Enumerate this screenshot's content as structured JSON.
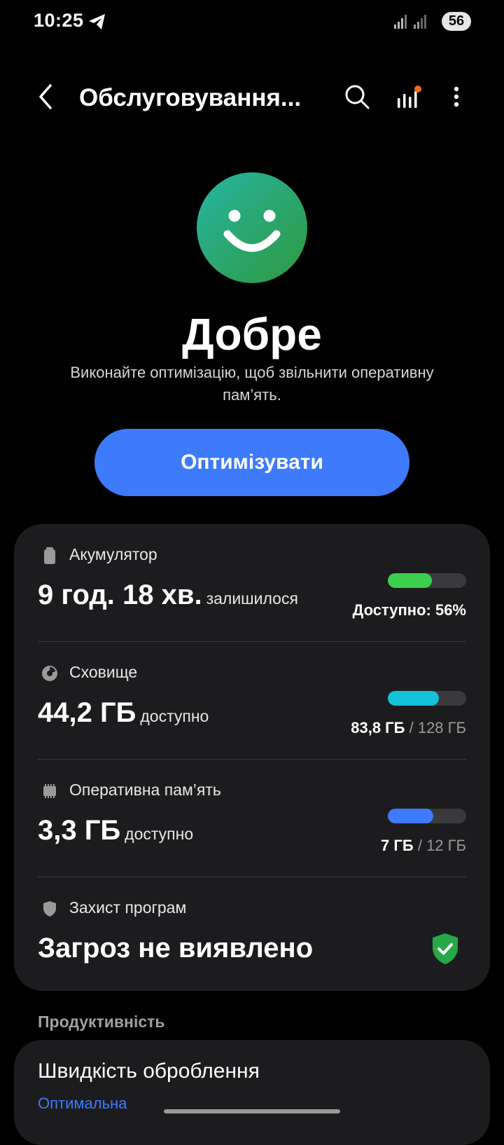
{
  "status_bar": {
    "time": "10:25",
    "battery": "56"
  },
  "app_bar": {
    "title": "Обслуговування..."
  },
  "status": {
    "word": "Добре",
    "description": "Виконайте оптимізацію, щоб звільнити оперативну пам’ять.",
    "button_label": "Оптимізувати"
  },
  "battery": {
    "label": "Акумулятор",
    "value": "9 год. 18 хв.",
    "suffix": "залишилося",
    "right_text": "Доступно: 56%",
    "level_percent": 56,
    "bar_color": "#3ccf4e"
  },
  "storage": {
    "label": "Сховище",
    "value": "44,2 ГБ",
    "suffix": "доступно",
    "used": "83,8 ГБ",
    "separator": "/",
    "total": "128 ГБ",
    "level_percent": 65.5,
    "bar_color": "#13c2d9"
  },
  "ram": {
    "label": "Оперативна пам’ять",
    "value": "3,3 ГБ",
    "suffix": "доступно",
    "used": "7 ГБ",
    "separator": "/",
    "total": "12 ГБ",
    "level_percent": 58,
    "bar_color": "#3d7bfc"
  },
  "app_protection": {
    "label": "Захист програм",
    "value": "Загроз не виявлено",
    "status_color": "#27a846"
  },
  "performance": {
    "heading": "Продуктивність",
    "item_title": "Швидкість оброблення",
    "item_value": "Оптимальна"
  },
  "icons": [
    "telegram-icon",
    "signal-icon",
    "back-arrow-icon",
    "search-icon",
    "stats-icon",
    "more-options-icon",
    "smiley-icon",
    "battery-icon",
    "storage-icon",
    "ram-icon",
    "shield-icon",
    "shield-check-icon"
  ],
  "colors": {
    "accent": "#3d7bfc",
    "card": "#1c1c1e",
    "background": "#000000"
  }
}
